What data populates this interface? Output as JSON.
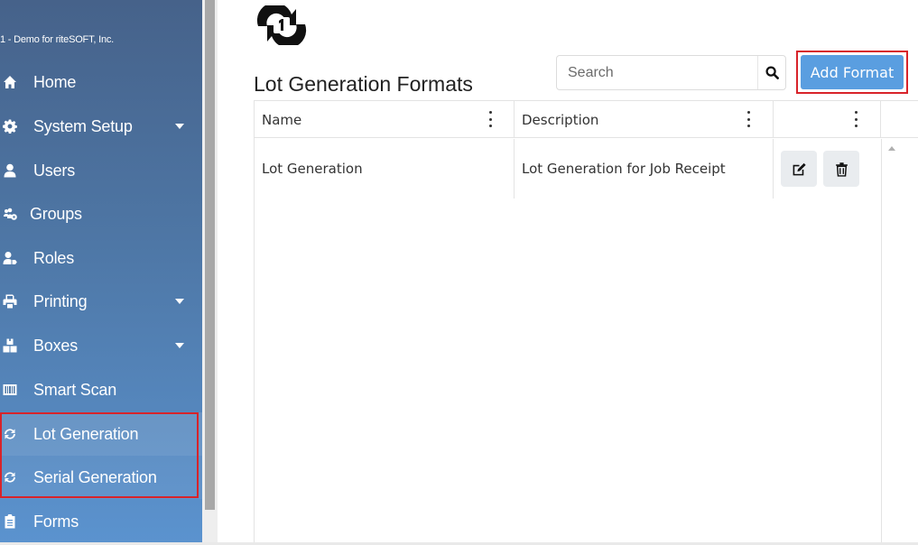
{
  "sidebar": {
    "company": "1 - Demo for riteSOFT, Inc.",
    "items": [
      {
        "label": "Home",
        "icon": "home-icon"
      },
      {
        "label": "System Setup",
        "icon": "gear-icon",
        "has_caret": true
      },
      {
        "label": "Users",
        "icon": "user-icon"
      },
      {
        "label": "Groups",
        "icon": "users-cog-icon"
      },
      {
        "label": "Roles",
        "icon": "user-tag-icon"
      },
      {
        "label": "Printing",
        "icon": "printer-icon",
        "has_caret": true
      },
      {
        "label": "Boxes",
        "icon": "boxes-icon",
        "has_caret": true
      },
      {
        "label": "Smart Scan",
        "icon": "barcode-icon"
      },
      {
        "label": "Lot Generation",
        "icon": "sync-icon"
      },
      {
        "label": "Serial Generation",
        "icon": "sync-icon"
      },
      {
        "label": "Forms",
        "icon": "clipboard-icon"
      }
    ]
  },
  "main": {
    "title": "Lot Generation Formats",
    "page_icon": "sync-one-icon",
    "search": {
      "placeholder": "Search",
      "value": ""
    },
    "add_button": "Add Format"
  },
  "grid": {
    "columns": [
      "Name",
      "Description",
      ""
    ],
    "rows": [
      {
        "name": "Lot Generation",
        "description": "Lot Generation for Job Receipt"
      }
    ]
  },
  "colors": {
    "accent": "#5a9ee0",
    "highlight": "#d8232a",
    "sidebar_top": "#46628a",
    "sidebar_bottom": "#5b93cf"
  }
}
